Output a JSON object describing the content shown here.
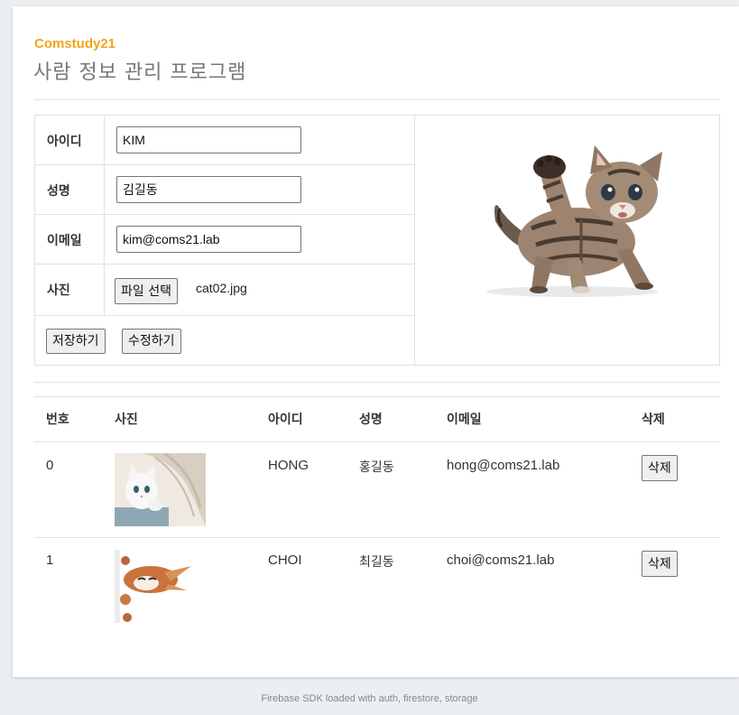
{
  "header": {
    "brand": "Comstudy21",
    "title": "사람 정보 관리 프로그램"
  },
  "form": {
    "id_label": "아이디",
    "id_value": "KIM",
    "name_label": "성명",
    "name_value": "김길동",
    "email_label": "이메일",
    "email_value": "kim@coms21.lab",
    "photo_label": "사진",
    "file_button": "파일 선택",
    "file_name": "cat02.jpg",
    "save_button": "저장하기",
    "edit_button": "수정하기"
  },
  "table": {
    "headers": [
      "번호",
      "사진",
      "아이디",
      "성명",
      "이메일",
      "삭제"
    ],
    "rows": [
      {
        "no": "0",
        "id": "HONG",
        "name": "홍길동",
        "email": "hong@coms21.lab",
        "delete": "삭제"
      },
      {
        "no": "1",
        "id": "CHOI",
        "name": "최길동",
        "email": "choi@coms21.lab",
        "delete": "삭제"
      }
    ]
  },
  "footer": {
    "text": "Firebase SDK loaded with auth, firestore, storage"
  }
}
